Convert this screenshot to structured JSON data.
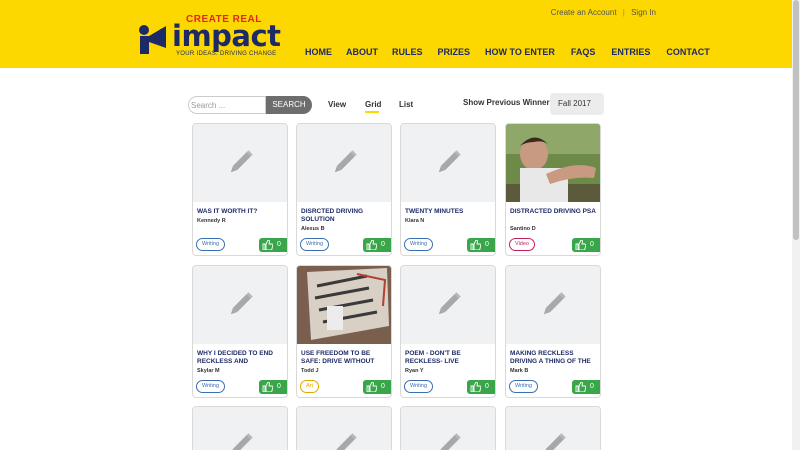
{
  "brand": {
    "logo_create": "CREATE REAL",
    "logo_impact": "impact",
    "logo_tagline": "YOUR IDEAS. DRIVING CHANGE"
  },
  "account": {
    "create_account": "Create an Account",
    "separator": "|",
    "sign_in": "Sign In"
  },
  "nav": [
    "HOME",
    "ABOUT",
    "RULES",
    "PRIZES",
    "HOW TO ENTER",
    "FAQS",
    "ENTRIES",
    "CONTACT"
  ],
  "toolbar": {
    "search_placeholder": "Search ...",
    "search_button": "SEARCH",
    "view_label": "View",
    "grid_label": "Grid",
    "list_label": "List",
    "prev_winners": "Show Previous Winners",
    "semester": "Fall 2017"
  },
  "entries": [
    {
      "title": "WAS IT WORTH IT?",
      "author": "Kennedy R",
      "type": "Writing",
      "likes": "0",
      "thumb": "placeholder"
    },
    {
      "title": "DISRCTED DRIVING SOLUTION",
      "author": "Alexus B",
      "type": "Writing",
      "likes": "0",
      "thumb": "placeholder"
    },
    {
      "title": "TWENTY MINUTES",
      "author": "Klara N",
      "type": "Writing",
      "likes": "0",
      "thumb": "placeholder"
    },
    {
      "title": "DISTRACTED DRIVING PSA",
      "author": "Santino D",
      "type": "Video",
      "likes": "0",
      "thumb": "photo"
    },
    {
      "title": "WHY I DECIDED TO END RECKLESS AND",
      "author": "Skylar M",
      "type": "Writing",
      "likes": "0",
      "thumb": "placeholder"
    },
    {
      "title": "USE FREEDOM TO BE SAFE: DRIVE WITHOUT",
      "author": "Todd J",
      "type": "Art",
      "likes": "0",
      "thumb": "art"
    },
    {
      "title": "POEM - DON'T BE RECKLESS- LIVE",
      "author": "Ryan Y",
      "type": "Writing",
      "likes": "0",
      "thumb": "placeholder"
    },
    {
      "title": "MAKING RECKLESS DRIVING A THING OF THE",
      "author": "Mark B",
      "type": "Writing",
      "likes": "0",
      "thumb": "placeholder"
    }
  ],
  "colors": {
    "brand_yellow": "#fdd800",
    "brand_navy": "#1e2a66",
    "like_green": "#3aa64a"
  }
}
